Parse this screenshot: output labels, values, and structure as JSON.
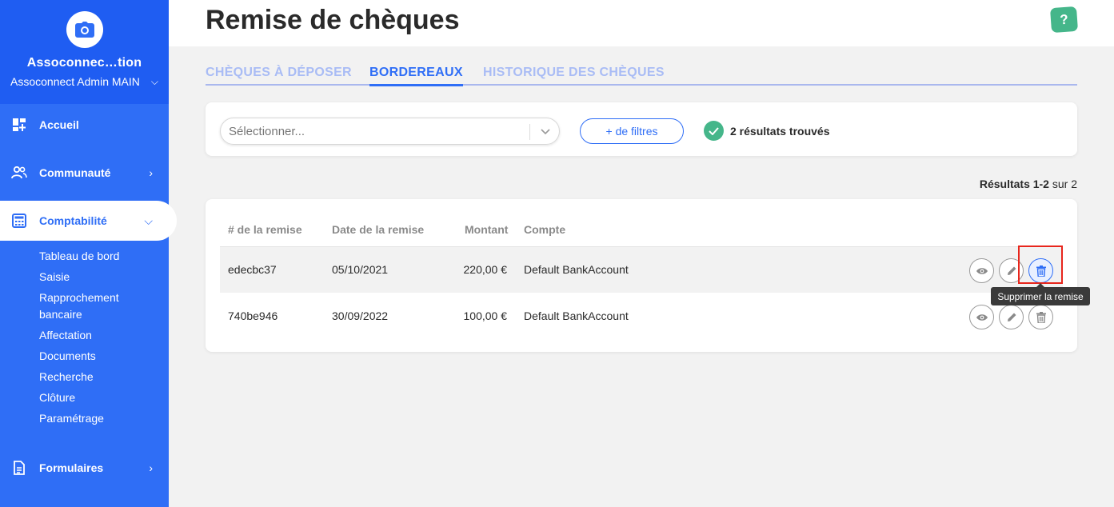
{
  "org": {
    "name": "Assoconnec…tion",
    "subtitle": "Assoconnect Admin MAIN"
  },
  "nav": {
    "accueil": "Accueil",
    "communaute": "Communauté",
    "comptabilite": "Comptabilité",
    "formulaires": "Formulaires",
    "sub_items": [
      "Tableau de bord",
      "Saisie",
      "Rapprochement bancaire",
      "Affectation",
      "Documents",
      "Recherche",
      "Clôture",
      "Paramétrage"
    ]
  },
  "header": {
    "title": "Remise de chèques",
    "help": "?"
  },
  "tabs": [
    {
      "label": "CHÈQUES À DÉPOSER"
    },
    {
      "label": "BORDEREAUX"
    },
    {
      "label": "HISTORIQUE DES CHÈQUES"
    }
  ],
  "filters": {
    "select_placeholder": "Sélectionner...",
    "more_filters": "+ de filtres",
    "results_found": "2 résultats trouvés"
  },
  "range": {
    "bold": "Résultats 1-2",
    "rest": " sur 2"
  },
  "table": {
    "headers": [
      "# de la remise",
      "Date de la remise",
      "Montant",
      "Compte"
    ],
    "rows": [
      {
        "id": "edecbc37",
        "date": "05/10/2021",
        "amount": "220,00 €",
        "account": "Default BankAccount"
      },
      {
        "id": "740be946",
        "date": "30/09/2022",
        "amount": "100,00 €",
        "account": "Default BankAccount"
      }
    ]
  },
  "tooltip": "Supprimer la remise",
  "colors": {
    "sidebar": "#2f6ef6",
    "accent": "#2f6ef6",
    "success": "#45b68a",
    "highlight": "#e8261c"
  }
}
